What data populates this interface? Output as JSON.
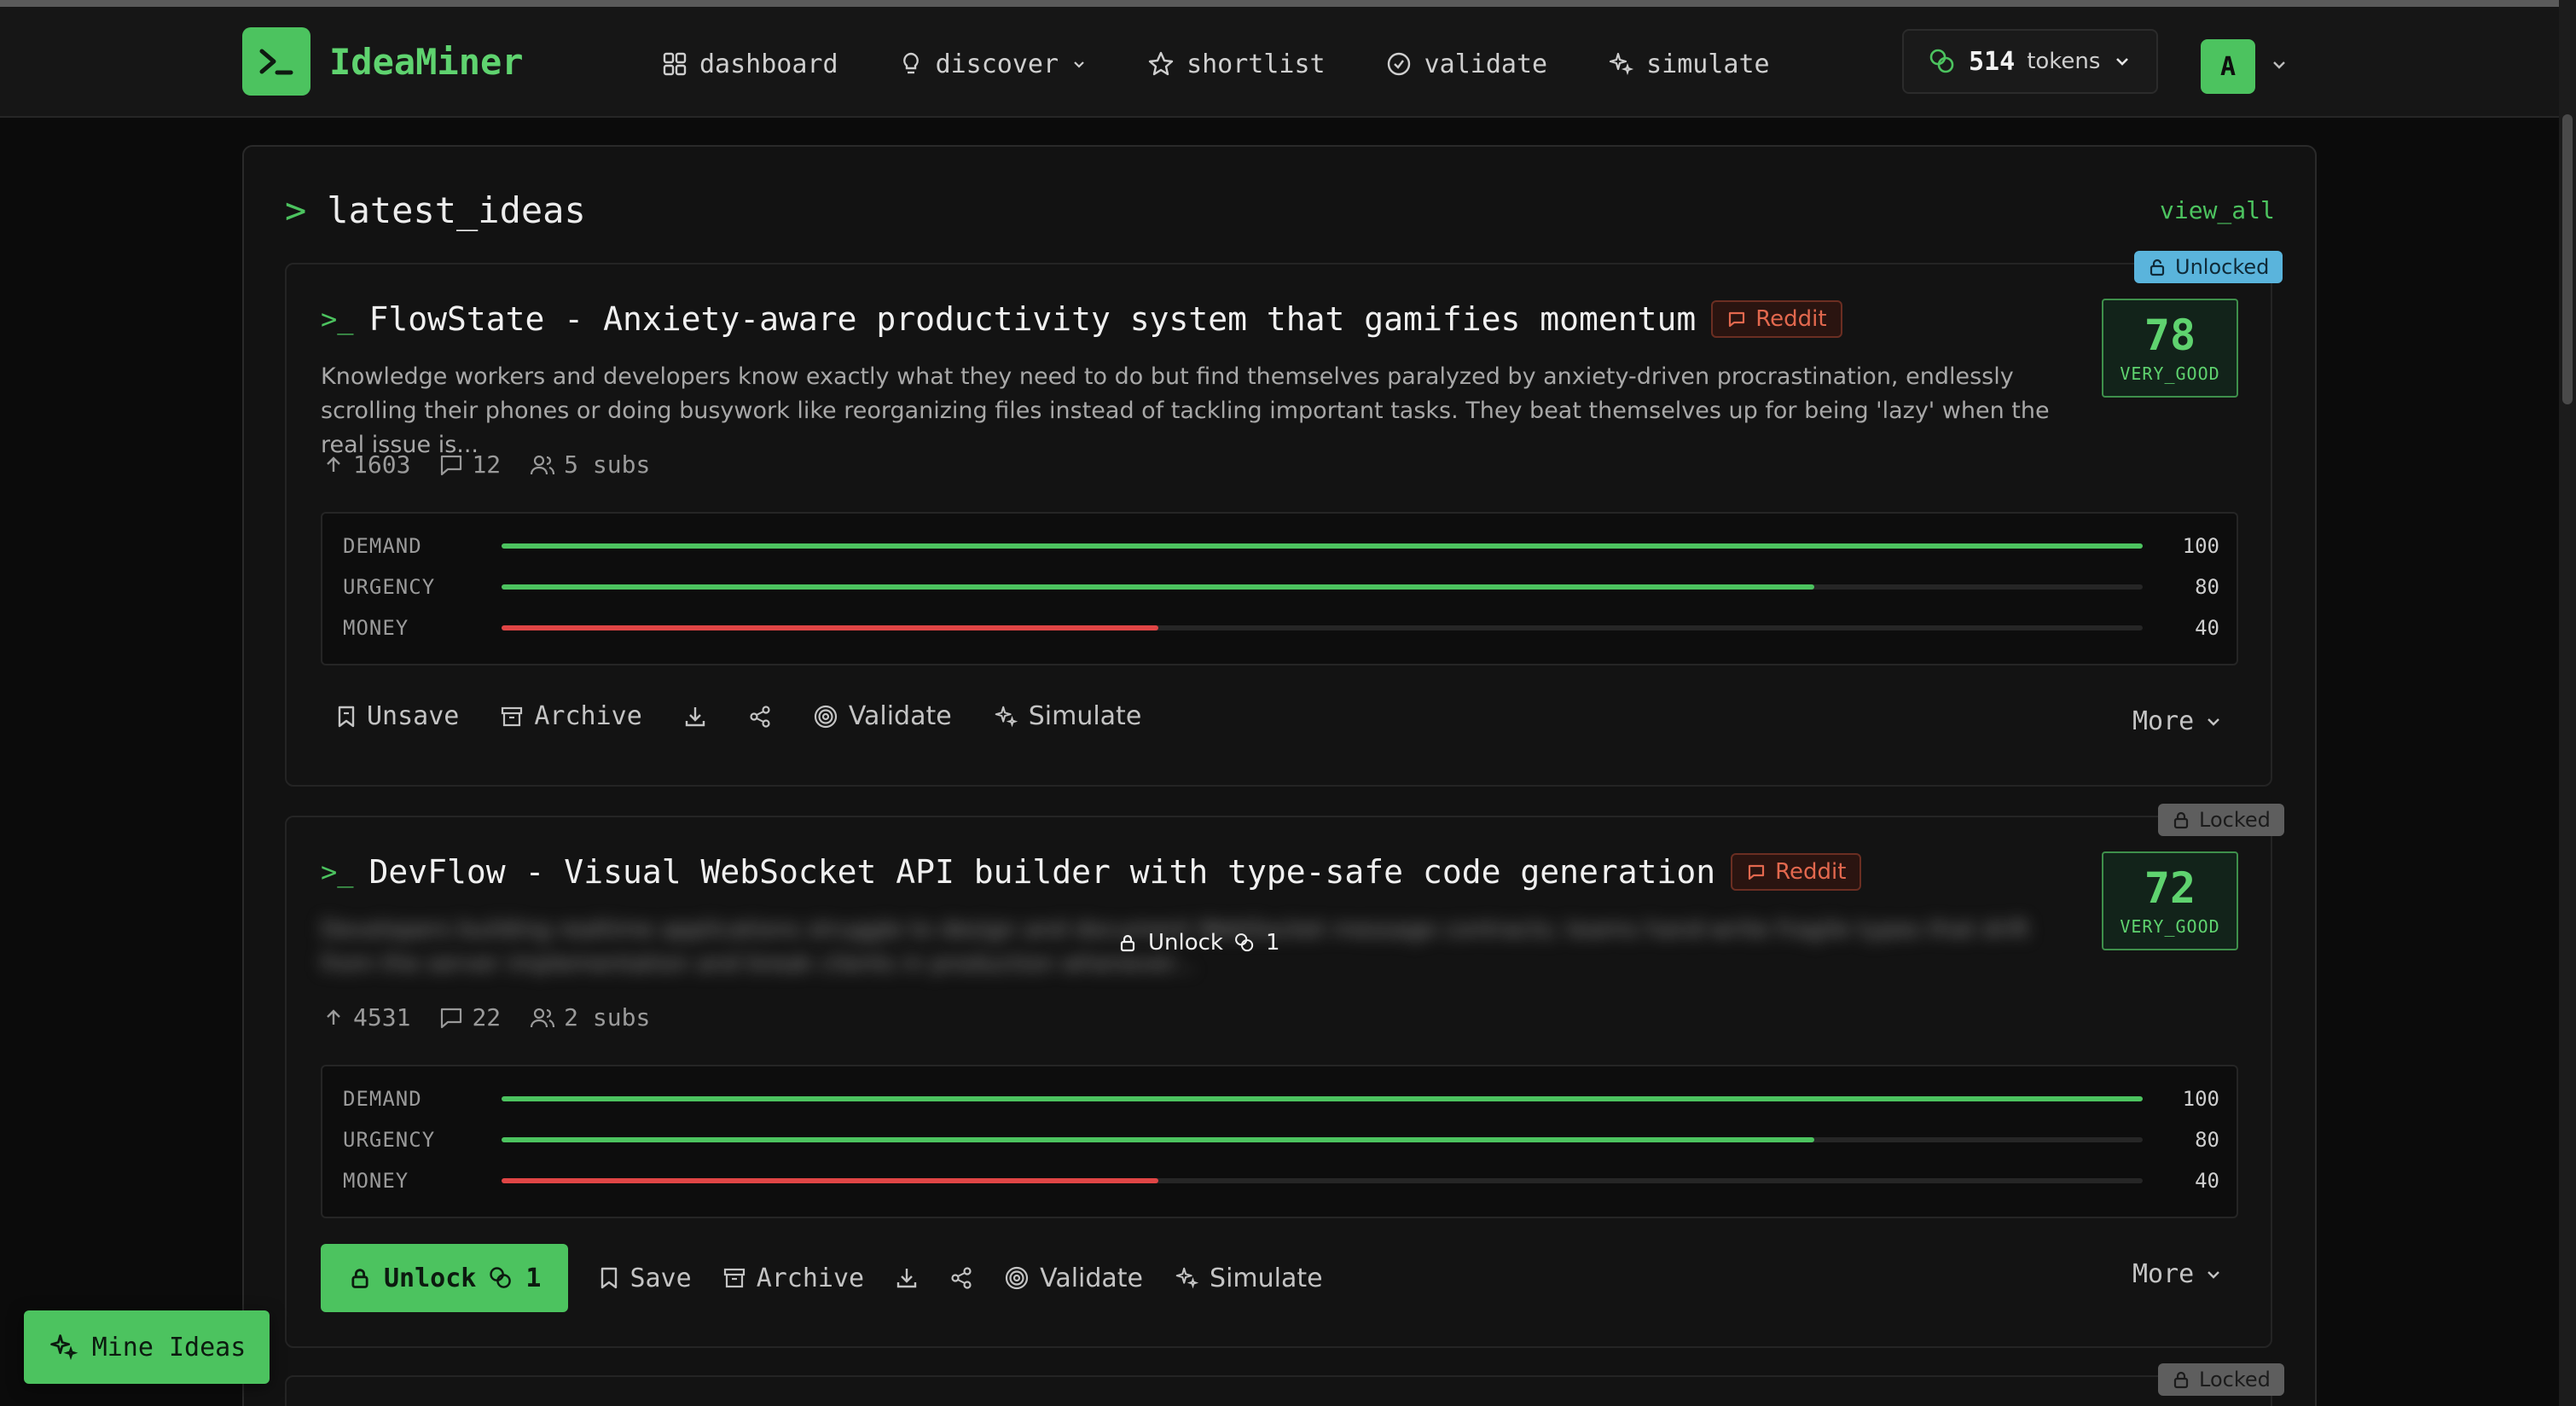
{
  "app": {
    "name": "IdeaMiner"
  },
  "nav": {
    "items": [
      {
        "label": "dashboard",
        "icon": "grid-icon"
      },
      {
        "label": "discover",
        "icon": "bulb-icon"
      },
      {
        "label": "shortlist",
        "icon": "star-icon"
      },
      {
        "label": "validate",
        "icon": "check-circle-icon"
      },
      {
        "label": "simulate",
        "icon": "sparkle-icon"
      }
    ]
  },
  "tokens": {
    "count": "514",
    "label": "tokens"
  },
  "user": {
    "initial": "A"
  },
  "section": {
    "title": "latest_ideas",
    "prompt": ">",
    "view_all": "view_all"
  },
  "ideas": [
    {
      "status": "Unlocked",
      "title": "FlowState - Anxiety-aware productivity system that gamifies momentum",
      "source": "Reddit",
      "description": "Knowledge workers and developers know exactly what they need to do but find themselves paralyzed by anxiety-driven procrastination, endlessly scrolling their phones or doing busywork like reorganizing files instead of tackling important tasks. They beat themselves up for being 'lazy' when the real issue is...",
      "score": "78",
      "score_label": "VERY_GOOD",
      "upvotes": "1603",
      "comments": "12",
      "subs": "5 subs",
      "metrics": [
        {
          "label": "DEMAND",
          "value": 100,
          "display": "100"
        },
        {
          "label": "URGENCY",
          "value": 80,
          "display": "80"
        },
        {
          "label": "MONEY",
          "value": 40,
          "display": "40"
        }
      ],
      "actions": {
        "save": "Unsave",
        "archive": "Archive",
        "validate": "Validate",
        "simulate": "Simulate",
        "more": "More"
      }
    },
    {
      "status": "Locked",
      "title": "DevFlow - Visual WebSocket API builder with type-safe code generation",
      "source": "Reddit",
      "description": "Developers building realtime applications struggle to design and document WebSocket message contracts; teams hand-write fragile types that drift from the server implementation and break clients in production whenever...",
      "unlock_label": "Unlock",
      "unlock_cost": "1",
      "score": "72",
      "score_label": "VERY_GOOD",
      "upvotes": "4531",
      "comments": "22",
      "subs": "2 subs",
      "metrics": [
        {
          "label": "DEMAND",
          "value": 100,
          "display": "100"
        },
        {
          "label": "URGENCY",
          "value": 80,
          "display": "80"
        },
        {
          "label": "MONEY",
          "value": 40,
          "display": "40"
        }
      ],
      "actions": {
        "unlock": "Unlock",
        "unlock_cost": "1",
        "save": "Save",
        "archive": "Archive",
        "validate": "Validate",
        "simulate": "Simulate",
        "more": "More"
      }
    },
    {
      "status": "Locked"
    }
  ],
  "mine_button": "Mine Ideas",
  "colors": {
    "accent": "#4cc35f",
    "unlocked": "#5ab4dc",
    "locked": "#5e5e5e",
    "money_bar": "#e04545",
    "reddit": "#e2684e"
  }
}
